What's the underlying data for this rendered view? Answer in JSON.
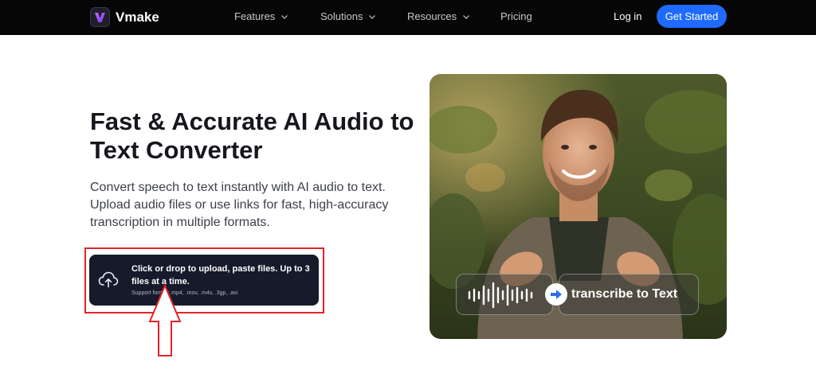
{
  "nav": {
    "brand": "Vmake",
    "items": [
      {
        "label": "Features"
      },
      {
        "label": "Solutions"
      },
      {
        "label": "Resources"
      },
      {
        "label": "Pricing"
      }
    ],
    "login": "Log in",
    "cta": "Get Started"
  },
  "hero": {
    "title": "Fast & Accurate AI Audio to Text Converter",
    "description": "Convert speech to text instantly with AI audio to text. Upload audio files or use links for fast, high-accuracy transcription in multiple formats.",
    "upload": {
      "main": "Click or drop to upload, paste files. Up to 3 files at a time.",
      "formats": "Support format:.mp4, .mov, .m4v, .3gp, .avi"
    }
  },
  "panel": {
    "caption": "transcribe to Text"
  },
  "colors": {
    "nav_bg": "#060606",
    "accent": "#1f6bff",
    "upload_bg": "#161b2b",
    "highlight": "#e3232a"
  }
}
